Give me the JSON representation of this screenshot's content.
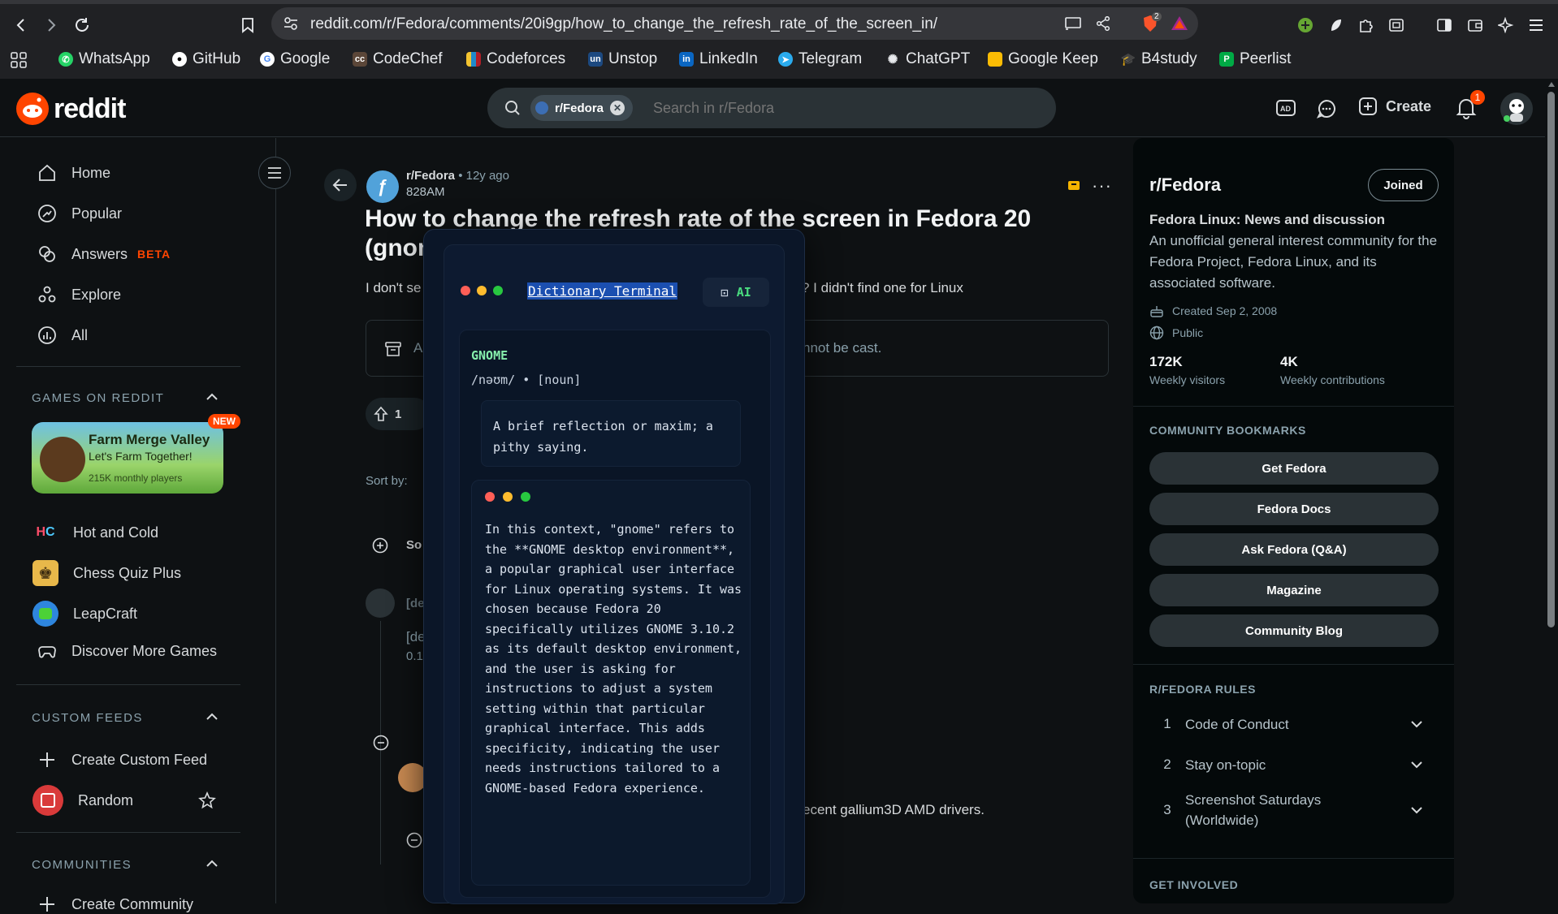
{
  "browser": {
    "url": "reddit.com/r/Fedora/comments/20i9gp/how_to_change_the_refresh_rate_of_the_screen_in/",
    "bookmarks": [
      "WhatsApp",
      "GitHub",
      "Google",
      "CodeChef",
      "Codeforces",
      "Unstop",
      "LinkedIn",
      "Telegram",
      "ChatGPT",
      "Google Keep",
      "B4study",
      "Peerlist"
    ],
    "shields_badge": "2"
  },
  "header": {
    "logo_text": "reddit",
    "chip_label": "r/Fedora",
    "search_placeholder": "Search in r/Fedora",
    "create_label": "Create",
    "notif_count": "1"
  },
  "leftnav": {
    "items": [
      {
        "label": "Home",
        "icon": "home-icon"
      },
      {
        "label": "Popular",
        "icon": "popular-icon"
      },
      {
        "label": "Answers",
        "badge": "BETA",
        "icon": "answers-icon"
      },
      {
        "label": "Explore",
        "icon": "explore-icon"
      },
      {
        "label": "All",
        "icon": "all-icon"
      }
    ],
    "games_section": "GAMES ON REDDIT",
    "featured_game": {
      "title": "Farm Merge Valley",
      "subtitle": "Let's Farm Together!",
      "players": "215K monthly players",
      "badge": "NEW"
    },
    "games": [
      "Hot and Cold",
      "Chess Quiz Plus",
      "LeapCraft",
      "Discover More Games"
    ],
    "custom_feeds_section": "CUSTOM FEEDS",
    "custom_feeds": [
      "Create Custom Feed",
      "Random"
    ],
    "communities_section": "COMMUNITIES",
    "communities_first": "Create Community"
  },
  "post": {
    "subreddit": "r/Fedora",
    "age": "• 12y ago",
    "author": "828AM",
    "title_line1": "How to change the refresh rate of the screen in Fedora 20",
    "title_line2": "(gnome)?",
    "body_left": "I don't se",
    "body_right": "? I didn't find one for Linux",
    "archived_left": "A",
    "archived_right": "nnot be cast.",
    "vote_count": "1",
    "sort_label": "Sort by:",
    "comment_search_partial": "So",
    "deleted_1": "[de",
    "deleted_2": "[de",
    "points_partial": "0.1",
    "comment_right": "ecent gallium3D AMD drivers."
  },
  "dict": {
    "title": "Dictionary Terminal",
    "ai_label": "AI",
    "word": "GNOME",
    "pron": "/nəʊm/ • [noun]",
    "definition": "A brief reflection or maxim; a pithy saying.",
    "context": "In this context, \"gnome\" refers to the **GNOME desktop environment**, a popular graphical user interface for Linux operating systems. It was chosen because Fedora 20 specifically utilizes GNOME 3.10.2 as its default desktop environment, and the user is asking for instructions to adjust a system setting within that particular graphical interface. This adds specificity, indicating the user needs instructions tailored to a GNOME-based Fedora experience."
  },
  "sidebar": {
    "name": "r/Fedora",
    "joined_label": "Joined",
    "tagline": "Fedora Linux: News and discussion",
    "description": "An unofficial general interest community for the Fedora Project, Fedora Linux, and its associated software.",
    "created": "Created Sep 2, 2008",
    "visibility": "Public",
    "visitors_value": "172K",
    "visitors_label": "Weekly visitors",
    "contrib_value": "4K",
    "contrib_label": "Weekly contributions",
    "bookmarks_title": "COMMUNITY BOOKMARKS",
    "bookmarks": [
      "Get Fedora",
      "Fedora Docs",
      "Ask Fedora (Q&A)",
      "Magazine",
      "Community Blog"
    ],
    "rules_title": "R/FEDORA RULES",
    "rules": [
      {
        "num": "1",
        "title": "Code of Conduct"
      },
      {
        "num": "2",
        "title": "Stay on-topic"
      },
      {
        "num": "3",
        "title": "Screenshot Saturdays (Worldwide)"
      }
    ],
    "get_involved": "GET INVOLVED"
  }
}
